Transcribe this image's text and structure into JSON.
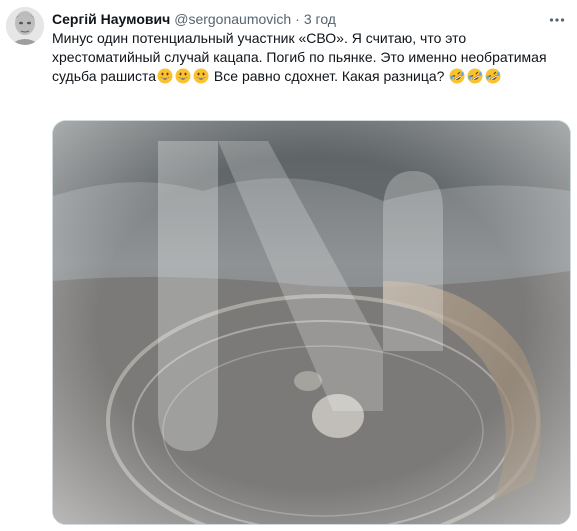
{
  "tweet": {
    "author_name": "Сергій Наумович",
    "handle": "@sergonaumovich",
    "separator": "·",
    "time": "3 год",
    "text_part1": "Минус один потенциальный участник «СВО». Я считаю, что это хрестоматийный случай кацапа. Погиб по пьянке. Это именно необратимая судьба рашиста",
    "text_part2": " Все равно сдохнет. Какая разница? ",
    "emoji_set_1": [
      "grinning-face",
      "grinning-face",
      "grinning-face"
    ],
    "emoji_set_2": [
      "rolling-on-floor-laughing",
      "rolling-on-floor-laughing",
      "rolling-on-floor-laughing"
    ]
  },
  "icons": {
    "more": "more-horizontal-icon",
    "avatar": "avatar"
  },
  "media": {
    "type": "video-frame",
    "watermark": "logo-watermark"
  },
  "colors": {
    "text_primary": "#0f1419",
    "text_secondary": "#536471",
    "border": "#cfd9de",
    "emoji_yellow": "#f9c22e"
  }
}
